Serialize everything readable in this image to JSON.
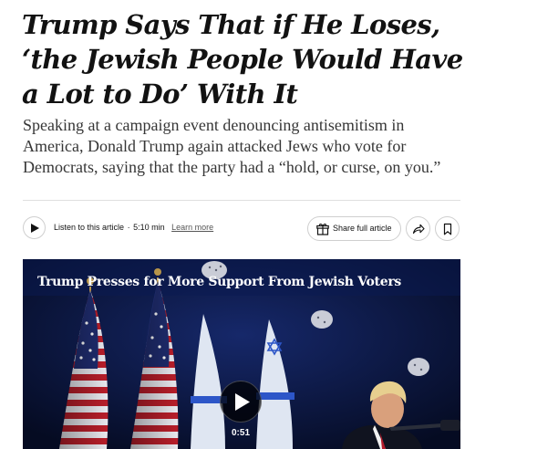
{
  "article": {
    "headline": "Trump Says That if He Loses, ‘the Jewish People Would Have a Lot to Do’ With It",
    "summary": "Speaking at a campaign event denouncing antisemitism in America, Donald Trump again attacked Jews who vote for Democrats, saying that the party had a “hold, or curse, on you.”"
  },
  "toolbar": {
    "listen_label": "Listen to this article",
    "separator": "·",
    "listen_duration": "5:10 min",
    "learn_more": "Learn more",
    "share_label": "Share full article",
    "icons": [
      "play-icon",
      "gift-icon",
      "forward-arrow-icon",
      "bookmark-icon"
    ]
  },
  "video": {
    "title": "Trump Presses for More Support From Jewish Voters",
    "duration": "0:51",
    "icons": [
      "play-icon"
    ]
  },
  "colors": {
    "headline": "#121212",
    "summary": "#363636",
    "divider": "#dfdfdf",
    "video_background": "#081234"
  }
}
